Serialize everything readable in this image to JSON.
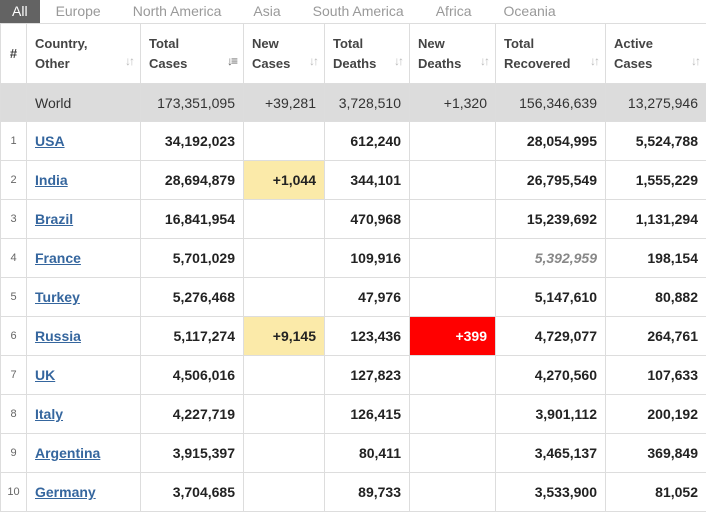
{
  "tabs": [
    {
      "label": "All",
      "active": true
    },
    {
      "label": "Europe",
      "active": false
    },
    {
      "label": "North America",
      "active": false
    },
    {
      "label": "Asia",
      "active": false
    },
    {
      "label": "South America",
      "active": false
    },
    {
      "label": "Africa",
      "active": false
    },
    {
      "label": "Oceania",
      "active": false
    }
  ],
  "columns": [
    {
      "key": "rank",
      "label": "#"
    },
    {
      "key": "country",
      "label": "Country, Other",
      "line1": "Country,",
      "line2": "Other",
      "sort": "unsorted"
    },
    {
      "key": "total_cases",
      "label": "Total Cases",
      "line1": "Total",
      "line2": "Cases",
      "sort": "descending"
    },
    {
      "key": "new_cases",
      "label": "New Cases",
      "line1": "New",
      "line2": "Cases",
      "sort": "unsorted"
    },
    {
      "key": "total_deaths",
      "label": "Total Deaths",
      "line1": "Total",
      "line2": "Deaths",
      "sort": "unsorted"
    },
    {
      "key": "new_deaths",
      "label": "New Deaths",
      "line1": "New",
      "line2": "Deaths",
      "sort": "unsorted"
    },
    {
      "key": "total_recovered",
      "label": "Total Recovered",
      "line1": "Total",
      "line2": "Recovered",
      "sort": "unsorted"
    },
    {
      "key": "active_cases",
      "label": "Active Cases",
      "line1": "Active",
      "line2": "Cases",
      "sort": "unsorted"
    }
  ],
  "world": {
    "rank": "",
    "country": "World",
    "total_cases": "173,351,095",
    "new_cases": "+39,281",
    "total_deaths": "3,728,510",
    "new_deaths": "+1,320",
    "total_recovered": "156,346,639",
    "active_cases": "13,275,946"
  },
  "rows": [
    {
      "rank": "1",
      "country": "USA",
      "total_cases": "34,192,023",
      "new_cases": "",
      "total_deaths": "612,240",
      "new_deaths": "",
      "total_recovered": "28,054,995",
      "active_cases": "5,524,788"
    },
    {
      "rank": "2",
      "country": "India",
      "total_cases": "28,694,879",
      "new_cases": "+1,044",
      "total_deaths": "344,101",
      "new_deaths": "",
      "total_recovered": "26,795,549",
      "active_cases": "1,555,229"
    },
    {
      "rank": "3",
      "country": "Brazil",
      "total_cases": "16,841,954",
      "new_cases": "",
      "total_deaths": "470,968",
      "new_deaths": "",
      "total_recovered": "15,239,692",
      "active_cases": "1,131,294"
    },
    {
      "rank": "4",
      "country": "France",
      "total_cases": "5,701,029",
      "new_cases": "",
      "total_deaths": "109,916",
      "new_deaths": "",
      "total_recovered": "5,392,959",
      "active_cases": "198,154",
      "recovered_estimated": true
    },
    {
      "rank": "5",
      "country": "Turkey",
      "total_cases": "5,276,468",
      "new_cases": "",
      "total_deaths": "47,976",
      "new_deaths": "",
      "total_recovered": "5,147,610",
      "active_cases": "80,882"
    },
    {
      "rank": "6",
      "country": "Russia",
      "total_cases": "5,117,274",
      "new_cases": "+9,145",
      "total_deaths": "123,436",
      "new_deaths": "+399",
      "total_recovered": "4,729,077",
      "active_cases": "264,761"
    },
    {
      "rank": "7",
      "country": "UK",
      "total_cases": "4,506,016",
      "new_cases": "",
      "total_deaths": "127,823",
      "new_deaths": "",
      "total_recovered": "4,270,560",
      "active_cases": "107,633"
    },
    {
      "rank": "8",
      "country": "Italy",
      "total_cases": "4,227,719",
      "new_cases": "",
      "total_deaths": "126,415",
      "new_deaths": "",
      "total_recovered": "3,901,112",
      "active_cases": "200,192"
    },
    {
      "rank": "9",
      "country": "Argentina",
      "total_cases": "3,915,397",
      "new_cases": "",
      "total_deaths": "80,411",
      "new_deaths": "",
      "total_recovered": "3,465,137",
      "active_cases": "369,849"
    },
    {
      "rank": "10",
      "country": "Germany",
      "total_cases": "3,704,685",
      "new_cases": "",
      "total_deaths": "89,733",
      "new_deaths": "",
      "total_recovered": "3,533,900",
      "active_cases": "81,052"
    }
  ],
  "colors": {
    "new_cases_highlight": "#fbeaa9",
    "new_deaths_highlight": "#ff0000",
    "link": "#35669e",
    "world_row_bg": "#dcdcdc",
    "active_tab_bg": "#636363"
  },
  "icons": {
    "sort_unsorted": "sort-arrows-icon",
    "sort_descending": "sort-descending-icon"
  }
}
